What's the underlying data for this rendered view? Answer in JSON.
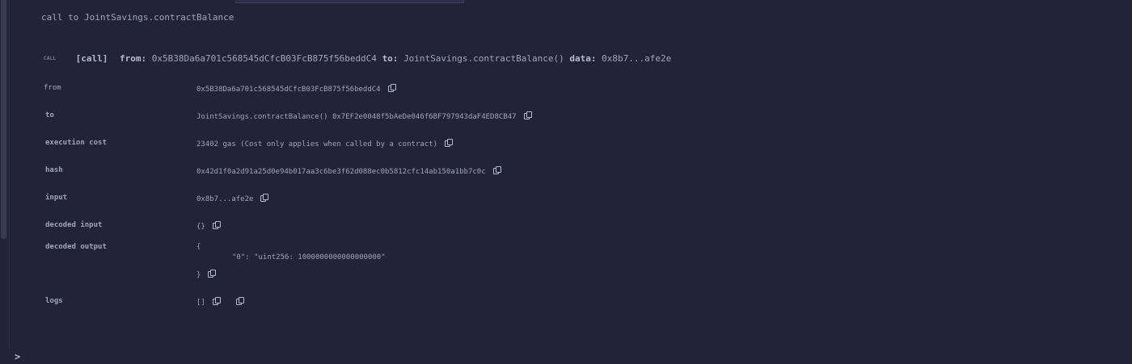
{
  "header": {
    "call_line": "call to JointSavings.contractBalance"
  },
  "summary": {
    "badge": "CALL",
    "kind": "[call]",
    "from_label": "from:",
    "from": "0x5B38Da6a701c568545dCfcB03FcB875f56beddC4",
    "to_label": "to:",
    "to": "JointSavings.contractBalance()",
    "data_label": "data:",
    "data": "0x8b7...afe2e"
  },
  "details": {
    "from": {
      "label": "from",
      "value": "0x5B38Da6a701c568545dCfcB03FcB875f56beddC4"
    },
    "to": {
      "label": "to",
      "value": "JointSavings.contractBalance() 0x7EF2e0048f5bAeDe046f6BF797943daF4ED8CB47"
    },
    "execution_cost": {
      "label": "execution cost",
      "value": "23402 gas (Cost only applies when called by a contract)"
    },
    "hash": {
      "label": "hash",
      "value": "0x42d1f0a2d91a25d0e94b017aa3c6be3f62d088ec0b5812cfc14ab150a1bb7c0c"
    },
    "input": {
      "label": "input",
      "value": "0x8b7...afe2e"
    },
    "decoded_input": {
      "label": "decoded input",
      "value": "{}"
    },
    "decoded_output": {
      "label": "decoded output",
      "open": "{",
      "entry": "\"0\": \"uint256: 1000000000000000000\"",
      "close": "}"
    },
    "logs": {
      "label": "logs",
      "value": "[]"
    }
  },
  "prompt": {
    "symbol": ">"
  }
}
